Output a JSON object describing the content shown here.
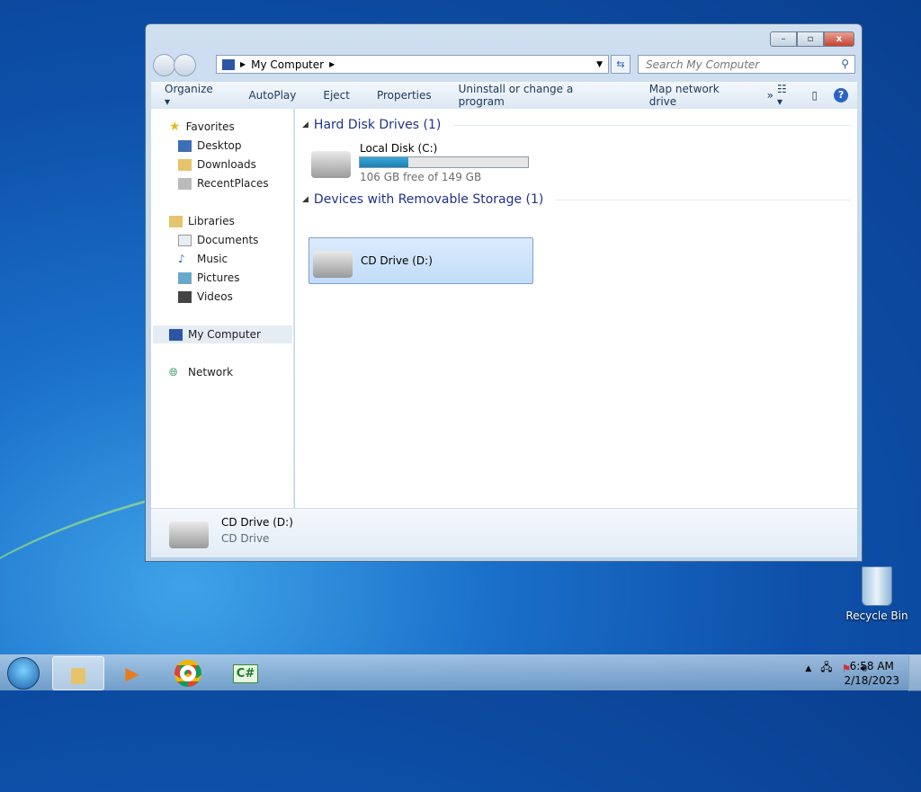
{
  "window": {
    "controls": {
      "minimize": "–",
      "maximize": "▫",
      "close": "x"
    },
    "address": {
      "path": "My Computer"
    },
    "search": {
      "placeholder": "Search My Computer"
    },
    "toolbar": {
      "organize": "Organize ▾",
      "autoplay": "AutoPlay",
      "eject": "Eject",
      "properties": "Properties",
      "uninstall": "Uninstall or change a program",
      "map_drive": "Map network drive",
      "more": "»"
    },
    "sidebar": {
      "favorites": "Favorites",
      "desktop": "Desktop",
      "downloads": "Downloads",
      "recent": "RecentPlaces",
      "libraries": "Libraries",
      "documents": "Documents",
      "music": "Music",
      "pictures": "Pictures",
      "videos": "Videos",
      "computer": "My Computer",
      "network": "Network"
    },
    "main": {
      "hdd_group": "Hard Disk Drives (1)",
      "removable_group": "Devices with Removable Storage (1)",
      "local_disk": {
        "name": "Local Disk (C:)",
        "free": "106 GB free of 149 GB",
        "used_percent": 29
      },
      "cd_drive": {
        "name": "CD Drive (D:)"
      }
    },
    "details": {
      "name": "CD Drive (D:)",
      "type": "CD Drive"
    }
  },
  "desktop": {
    "recycle_bin": "Recycle Bin"
  },
  "taskbar": {
    "time": "6:58 AM",
    "date": "2/18/2023"
  },
  "colors": {
    "accent": "#1e3287",
    "progress": "#1b7fb0"
  }
}
